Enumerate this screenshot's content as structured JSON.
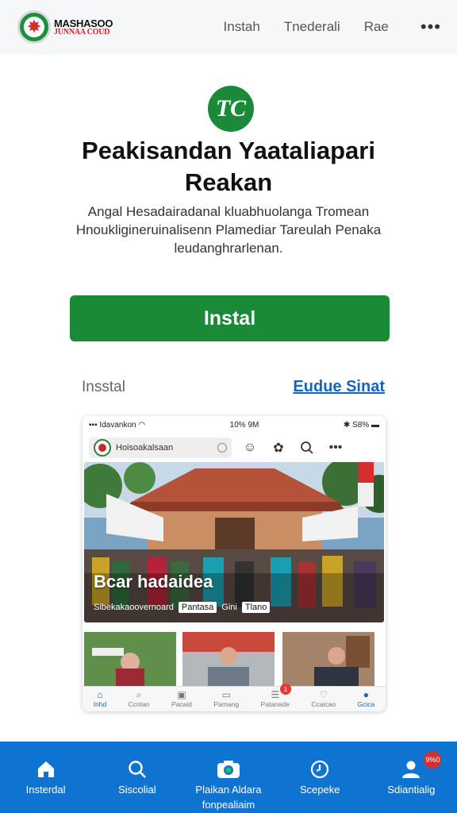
{
  "header": {
    "logo_line1": "MASHASOO",
    "logo_line2": "JUNNAA COUD",
    "nav": [
      "Instah",
      "Tnederali",
      "Rae"
    ],
    "more_icon": "more-horizontal-icon"
  },
  "hero": {
    "logo_text": "TC",
    "title": "Peakisandan Yaataliapari Reakan",
    "description": "Angal Hesadairadanal kluabhuolanga Tromean Hnoukligineruinalisenn Plamediar Tareulah Penaka leudanghrarlenan.",
    "install_label": "Instal",
    "secondary_label": "Insstal",
    "secondary_link": "Eudue Sinat"
  },
  "preview": {
    "status_left": "Idavankon",
    "status_mid": "10% 9M",
    "status_right": "S8%",
    "search_text": "Hoisoakalsaan",
    "hero_caption": "Bcar hadaidea",
    "hero_sub": "Sibekakaoovernoard",
    "chip1": "Pantasa",
    "chip2": "Gini",
    "chip3": "Tlano",
    "tabs": [
      {
        "label": "Inhd",
        "icon": "home-icon"
      },
      {
        "label": "Ccntan",
        "icon": "search-icon"
      },
      {
        "label": "Pacaid",
        "icon": "camera-icon"
      },
      {
        "label": "Pamang",
        "icon": "doc-icon"
      },
      {
        "label": "Patanade",
        "icon": "list-icon"
      },
      {
        "label": "Ccaicao",
        "icon": "heart-icon"
      },
      {
        "label": "Gcica",
        "icon": "person-icon"
      }
    ],
    "tab_badge": "1"
  },
  "bottomnav": {
    "items": [
      {
        "label": "Insterdal",
        "icon": "home-icon"
      },
      {
        "label": "Siscolial",
        "icon": "search-icon"
      },
      {
        "label": "Plaikan Aldara fonpealiaim",
        "icon": "camera-icon"
      },
      {
        "label": "Scepeke",
        "icon": "clock-icon"
      },
      {
        "label": "Sdiantialig",
        "icon": "person-icon"
      }
    ],
    "badge": "9%0"
  },
  "colors": {
    "primary_green": "#1b8a37",
    "bottom_nav_blue": "#0f74d1",
    "link_blue": "#1565c0"
  }
}
